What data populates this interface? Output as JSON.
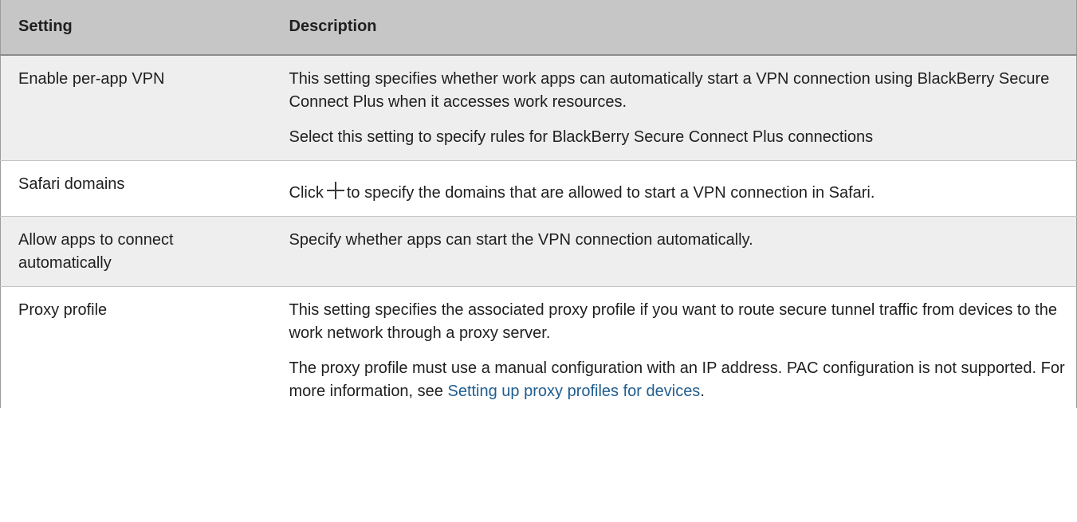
{
  "table": {
    "headers": {
      "setting": "Setting",
      "description": "Description"
    },
    "rows": [
      {
        "setting": "Enable per-app VPN",
        "paragraphs": [
          "This setting specifies whether work apps can automatically start a VPN connection using BlackBerry Secure Connect Plus when it accesses work resources.",
          "Select this setting to specify rules for BlackBerry Secure Connect Plus connections"
        ]
      },
      {
        "setting": "Safari domains",
        "before_icon": "Click",
        "icon": "plus-icon",
        "after_icon": "to specify the domains that are allowed to start a VPN connection in Safari."
      },
      {
        "setting": "Allow apps to connect automatically",
        "paragraphs": [
          "Specify whether apps can start the VPN connection automatically."
        ]
      },
      {
        "setting": "Proxy profile",
        "paragraphs": [
          "This setting specifies the associated proxy profile if you want to route secure tunnel traffic from devices to the work network through a proxy server."
        ],
        "note_text": "The proxy profile must use a manual configuration with an IP address. PAC configuration is not supported. For more information, see",
        "link_text": "Setting up proxy profiles for devices",
        "note_end": "."
      }
    ]
  },
  "colors": {
    "header_bg": "#c6c6c6",
    "shaded_row_bg": "#eeeeee",
    "link": "#1f5d8f"
  }
}
